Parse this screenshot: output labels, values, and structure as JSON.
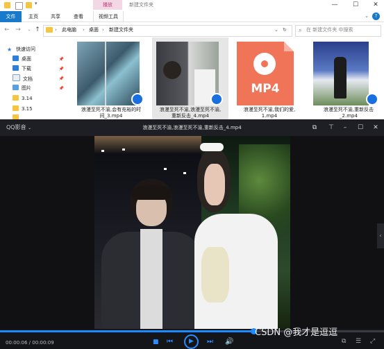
{
  "explorer": {
    "tool_tab": "播放",
    "window_title": "新建文件夹",
    "tabs": [
      "文件",
      "主页",
      "共享",
      "查看",
      "视频工具"
    ],
    "address": [
      "此电脑",
      "桌面",
      "新建文件夹"
    ],
    "search_placeholder": "在 新建文件夹 中搜索",
    "sidebar": [
      {
        "label": "快速访问",
        "pinned": false
      },
      {
        "label": "桌面",
        "pinned": true
      },
      {
        "label": "下载",
        "pinned": true
      },
      {
        "label": "文档",
        "pinned": true
      },
      {
        "label": "图片",
        "pinned": true
      },
      {
        "label": "3.14",
        "pinned": false
      },
      {
        "label": "3.15",
        "pinned": false
      }
    ],
    "files": [
      {
        "line1": "浪漫至死不渝,会有充裕的时",
        "line2": "间_3.mp4"
      },
      {
        "line1": "浪漫至死不渝,浪漫至死不渝,",
        "line2": "重新反击_4.mp4"
      },
      {
        "line1": "浪漫至死不渝,我们的爱,",
        "line2": "1.mp4",
        "thumb_text": "MP4"
      },
      {
        "line1": "浪漫至死不渝,重新反击",
        "line2": "_2.mp4"
      }
    ]
  },
  "player": {
    "app_name": "QQ影音",
    "file_title": "浪漫至死不渝,浪漫至死不渝,重新反击_4.mp4",
    "time": "00:00:06 / 00:00:09",
    "progress": 0.66,
    "watermark": "CSDN @我才是逗逗"
  },
  "colors": {
    "accent": "#1979ca",
    "player_accent": "#1a8cff",
    "mp4_orange": "#f07558"
  }
}
